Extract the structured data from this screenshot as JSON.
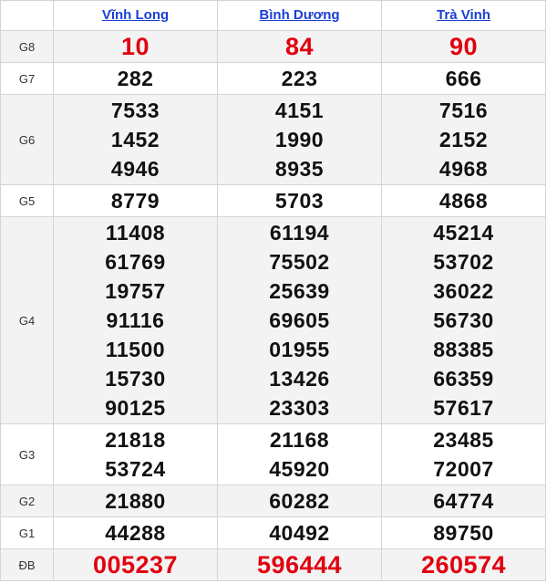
{
  "provinces": [
    "Vĩnh Long",
    "Bình Dương",
    "Trà Vinh"
  ],
  "prizes": [
    {
      "label": "G8",
      "numbers": [
        [
          "10"
        ],
        [
          "84"
        ],
        [
          "90"
        ]
      ],
      "highlight": true
    },
    {
      "label": "G7",
      "numbers": [
        [
          "282"
        ],
        [
          "223"
        ],
        [
          "666"
        ]
      ],
      "highlight": false
    },
    {
      "label": "G6",
      "numbers": [
        [
          "7533",
          "1452",
          "4946"
        ],
        [
          "4151",
          "1990",
          "8935"
        ],
        [
          "7516",
          "2152",
          "4968"
        ]
      ],
      "highlight": false
    },
    {
      "label": "G5",
      "numbers": [
        [
          "8779"
        ],
        [
          "5703"
        ],
        [
          "4868"
        ]
      ],
      "highlight": false
    },
    {
      "label": "G4",
      "numbers": [
        [
          "11408",
          "61769",
          "19757",
          "91116",
          "11500",
          "15730",
          "90125"
        ],
        [
          "61194",
          "75502",
          "25639",
          "69605",
          "01955",
          "13426",
          "23303"
        ],
        [
          "45214",
          "53702",
          "36022",
          "56730",
          "88385",
          "66359",
          "57617"
        ]
      ],
      "highlight": false
    },
    {
      "label": "G3",
      "numbers": [
        [
          "21818",
          "53724"
        ],
        [
          "21168",
          "45920"
        ],
        [
          "23485",
          "72007"
        ]
      ],
      "highlight": false
    },
    {
      "label": "G2",
      "numbers": [
        [
          "21880"
        ],
        [
          "60282"
        ],
        [
          "64774"
        ]
      ],
      "highlight": false
    },
    {
      "label": "G1",
      "numbers": [
        [
          "44288"
        ],
        [
          "40492"
        ],
        [
          "89750"
        ]
      ],
      "highlight": false
    },
    {
      "label": "ĐB",
      "numbers": [
        [
          "005237"
        ],
        [
          "596444"
        ],
        [
          "260574"
        ]
      ],
      "highlight": true
    }
  ],
  "colors": {
    "highlight": "#e1000f",
    "link": "#1a3fd6",
    "shade": "#f3f3f3"
  }
}
